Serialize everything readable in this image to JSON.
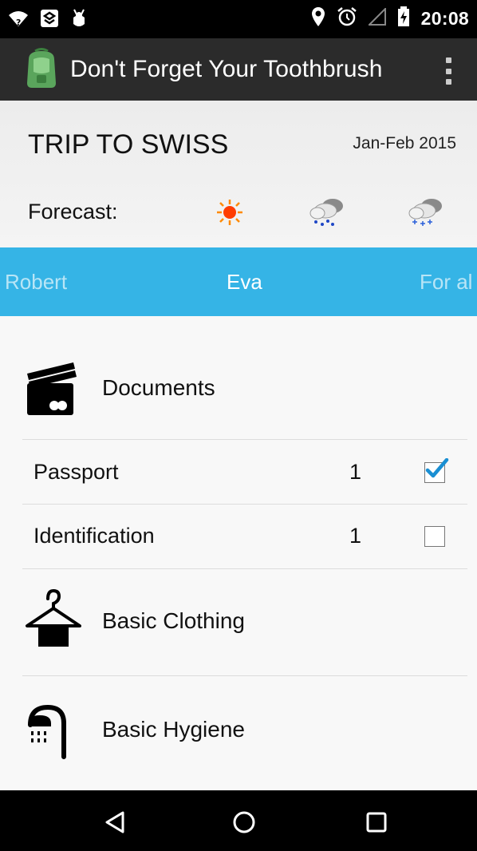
{
  "status_bar": {
    "time": "20:08",
    "left_icons": [
      "wifi-unknown-icon",
      "notification-app-icon",
      "android-debug-icon"
    ],
    "right_icons": [
      "location-pin-icon",
      "alarm-clock-icon",
      "signal-icon",
      "battery-charging-icon"
    ]
  },
  "app_bar": {
    "title": "Don't Forget Your Toothbrush",
    "logo_icon": "backpack-icon",
    "overflow_icon": "overflow-menu-icon"
  },
  "trip": {
    "title": "TRIP TO SWISS",
    "dates": "Jan-Feb 2015",
    "forecast_label": "Forecast:",
    "forecast_icons": [
      "sunny-icon",
      "rain-cloud-icon",
      "snow-cloud-icon"
    ]
  },
  "tabs": [
    "Robert",
    "Eva",
    "For al"
  ],
  "active_tab": "Eva",
  "categories": [
    {
      "label": "Documents",
      "icon": "cards-icon",
      "items": [
        {
          "name": "Passport",
          "qty": "1",
          "checked": true
        },
        {
          "name": "Identification",
          "qty": "1",
          "checked": false
        }
      ]
    },
    {
      "label": "Basic Clothing",
      "icon": "hanger-icon",
      "items": []
    },
    {
      "label": "Basic Hygiene",
      "icon": "shower-icon",
      "items": []
    }
  ],
  "nav_bar": {
    "buttons": [
      "back-icon",
      "home-icon",
      "recents-icon"
    ]
  },
  "colors": {
    "tab_bar": "#35b4e6",
    "app_bar": "#2b2b2b",
    "check_accent": "#1a8fd3"
  }
}
